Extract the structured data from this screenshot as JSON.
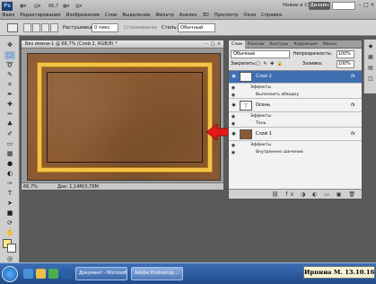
{
  "app": {
    "logo": "Ps",
    "zoom": "66,7",
    "menu": [
      "Файл",
      "Редактирование",
      "Изображение",
      "Слои",
      "Выделение",
      "Фильтр",
      "Анализ",
      "3D",
      "Просмотр",
      "Окно",
      "Справка"
    ],
    "workspace_label": "Новое в CS 5",
    "design_label": "Дизайн"
  },
  "options": {
    "feather_label": "Растушевка:",
    "feather_value": "0 пикс",
    "antialias_label": "Сглаживание",
    "style_label": "Стиль:",
    "style_value": "Обычный"
  },
  "document": {
    "title": "Без имени-1 @ 66,7% (Слой 2, RGB/8) *",
    "zoom": "66,7%",
    "doc_size": "Док: 1,14М/3,76М",
    "colors": {
      "background": "#8b5a32",
      "frame": "#f4c34a",
      "inner_line": "#2a1a0c"
    }
  },
  "arrow": {
    "color": "#e21a1a"
  },
  "layers_panel": {
    "tabs": [
      "Слои",
      "Каналы",
      "Контуры",
      "Коррекция",
      "Маски"
    ],
    "blend_mode": "Обычные",
    "opacity_label": "Непрозрачность:",
    "opacity_value": "100%",
    "lock_label": "Закрепить:",
    "fill_label": "Заливка:",
    "fill_value": "100%",
    "layers": [
      {
        "name": "Слой 2",
        "selected": true,
        "effects_label": "Эффекты",
        "effect": "Выполнить обводку"
      },
      {
        "name": "Осень",
        "selected": false,
        "effects_label": "Эффекты",
        "effect": "Тень"
      },
      {
        "name": "Слой 1",
        "selected": false,
        "effects_label": "Эффекты",
        "effect": "Внутреннее свечение"
      }
    ],
    "fx_symbol": "fx"
  },
  "taskbar": {
    "tasks": [
      "Документ - Microsoft...",
      "Adobe Photoshop..."
    ]
  },
  "watermark": "Ирпина М. 13.10.16"
}
